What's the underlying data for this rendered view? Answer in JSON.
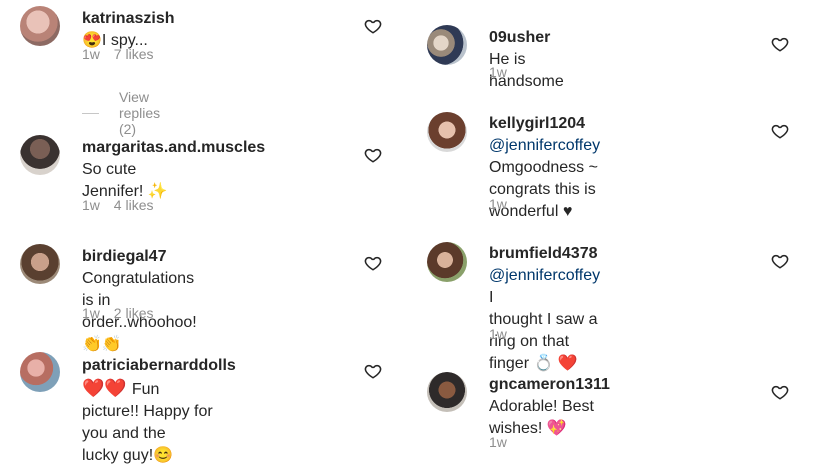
{
  "left": {
    "c1": {
      "username": "katrinaszish",
      "emoji": "😍",
      "text": "I spy...",
      "time": "1w",
      "likes": "7 likes",
      "view_replies": "View replies (2)"
    },
    "c2": {
      "username": "margaritas.and.muscles",
      "text1": " So cute",
      "text2": "Jennifer! ",
      "emoji": "✨",
      "time": "1w",
      "likes": "4 likes"
    },
    "c3": {
      "username": "birdiegal47",
      "text1": " Congratulations is in",
      "text2": "order..whoohoo!",
      "emoji": "👏👏",
      "time": "1w",
      "likes": "2 likes"
    },
    "c4": {
      "username": "patriciabernarddolls",
      "hearts": " ❤️❤️ ",
      "text1": "Fun",
      "text2": "picture!! Happy for you and the",
      "text3": "lucky guy!",
      "emoji": "😊"
    }
  },
  "right": {
    "c1": {
      "username": "09usher",
      "text": " He is handsome",
      "time": "1w"
    },
    "c2": {
      "username": "kellygirl1204",
      "mention": " @jennifercoffey",
      "text1": "Omgoodness ~ congrats this is",
      "text2": "wonderful ",
      "heart": "♥",
      "time": "1w"
    },
    "c3": {
      "username": "brumfield4378",
      "mention": " @jennifercoffey",
      "text1": " I",
      "text2": "thought I saw a ring on that",
      "text3": "finger ",
      "emoji": "💍 ❤️",
      "time": "1w"
    },
    "c4": {
      "username": "gncameron1311",
      "text1": " Adorable! Best",
      "text2": "wishes! ",
      "emoji": "💖",
      "time": "1w"
    }
  },
  "icons": {
    "like": "heart-outline-icon"
  },
  "colors": {
    "text": "#262626",
    "meta": "#8e8e8e",
    "mention": "#00376b",
    "heart": "#e0102f"
  }
}
